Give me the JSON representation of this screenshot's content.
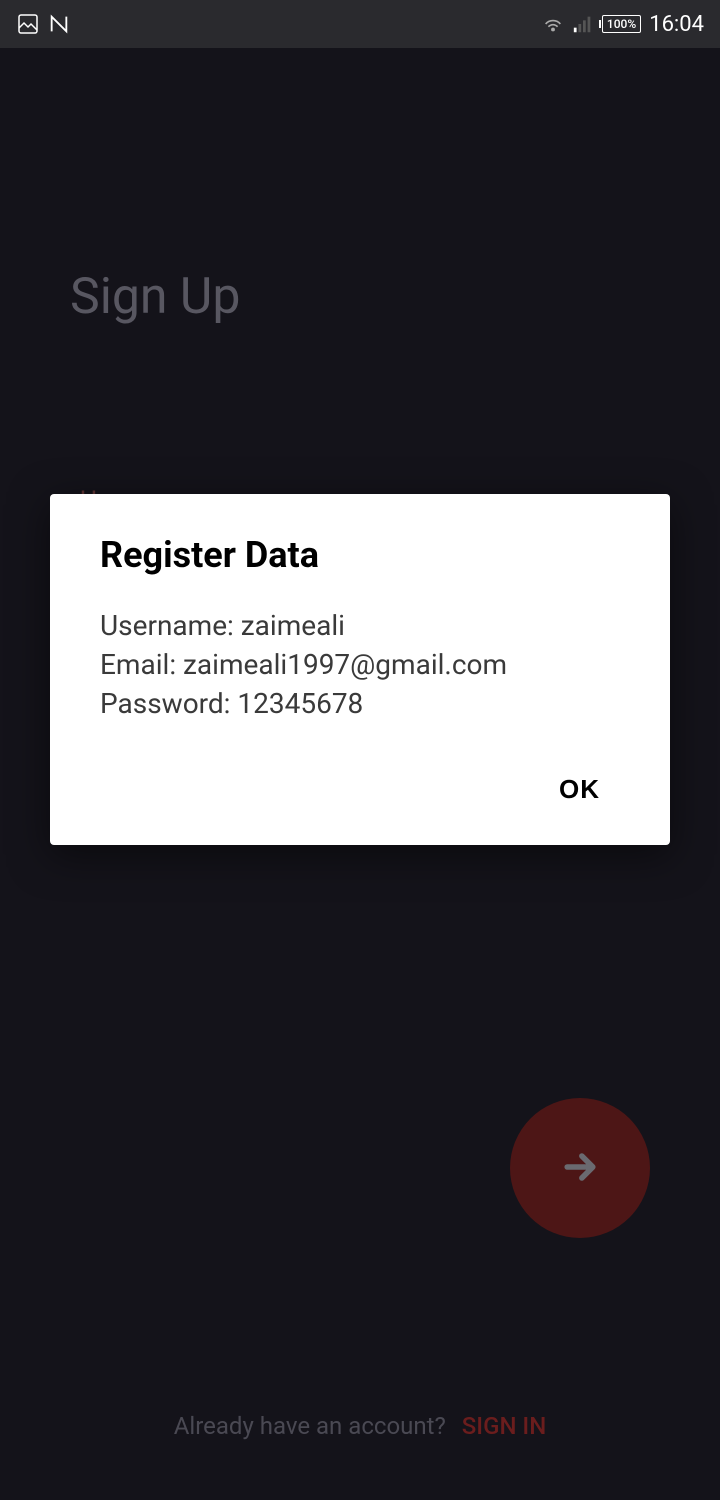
{
  "statusBar": {
    "battery": "100%",
    "time": "16:04"
  },
  "page": {
    "title": "Sign Up",
    "usernameLabel": "Username",
    "footer": {
      "text": "Already have an account?",
      "link": "SIGN IN"
    }
  },
  "dialog": {
    "title": "Register Data",
    "lines": {
      "username": "Username: zaimeali",
      "email": "Email: zaimeali1997@gmail.com",
      "password": "Password: 12345678"
    },
    "ok": "OK"
  }
}
